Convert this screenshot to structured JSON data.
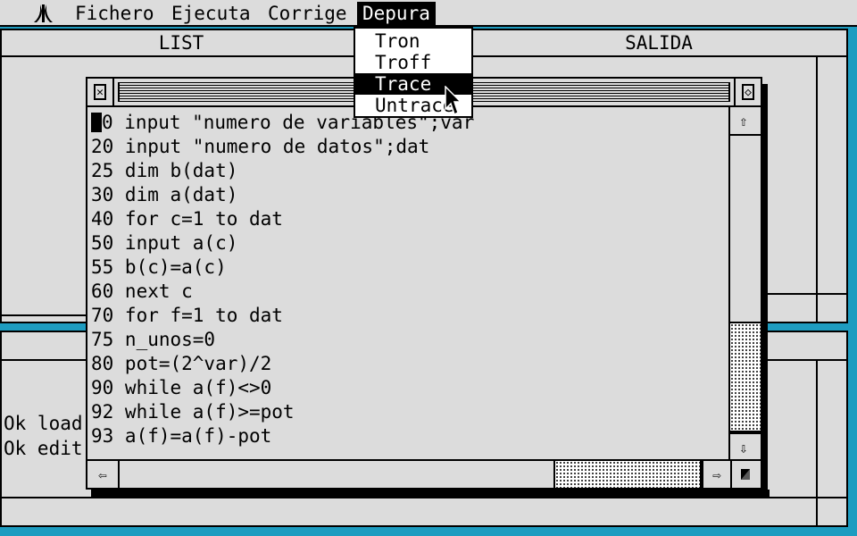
{
  "menubar": {
    "logo": "atari-fuji-logo",
    "items": [
      {
        "label": "Fichero"
      },
      {
        "label": "Ejecuta"
      },
      {
        "label": "Corrige"
      },
      {
        "label": "Depura",
        "active": true
      }
    ]
  },
  "dropdown": {
    "items": [
      {
        "label": "Tron"
      },
      {
        "label": "Troff"
      },
      {
        "label": "Trace",
        "highlighted": true
      },
      {
        "label": "Untrace"
      }
    ]
  },
  "windows": {
    "list": {
      "title": "LIST"
    },
    "salida": {
      "title": "SALIDA"
    },
    "command": {
      "lines": [
        "Ok load",
        "Ok edit"
      ]
    }
  },
  "editor": {
    "close_icon": "close-box-icon",
    "fuller_icon": "fuller-box-icon",
    "code_lines": [
      "10 input \"numero de variables\";var",
      "20 input \"numero de datos\";dat",
      "25 dim b(dat)",
      "30 dim a(dat)",
      "40 for c=1 to dat",
      "50 input a(c)",
      "55 b(c)=a(c)",
      "60 next c",
      "70 for f=1 to dat",
      "75 n_unos=0",
      "80 pot=(2^var)/2",
      "90 while a(f)<>0",
      "92 while a(f)>=pot",
      "93 a(f)=a(f)-pot"
    ],
    "scroll": {
      "up_icon": "arrow-up-icon",
      "down_icon": "arrow-down-icon",
      "left_icon": "arrow-left-icon",
      "right_icon": "arrow-right-icon",
      "size_icon": "resize-box-icon"
    }
  },
  "colors": {
    "desktop": "#1e9cc0",
    "window": "#dcdcdc",
    "ink": "#000000"
  }
}
